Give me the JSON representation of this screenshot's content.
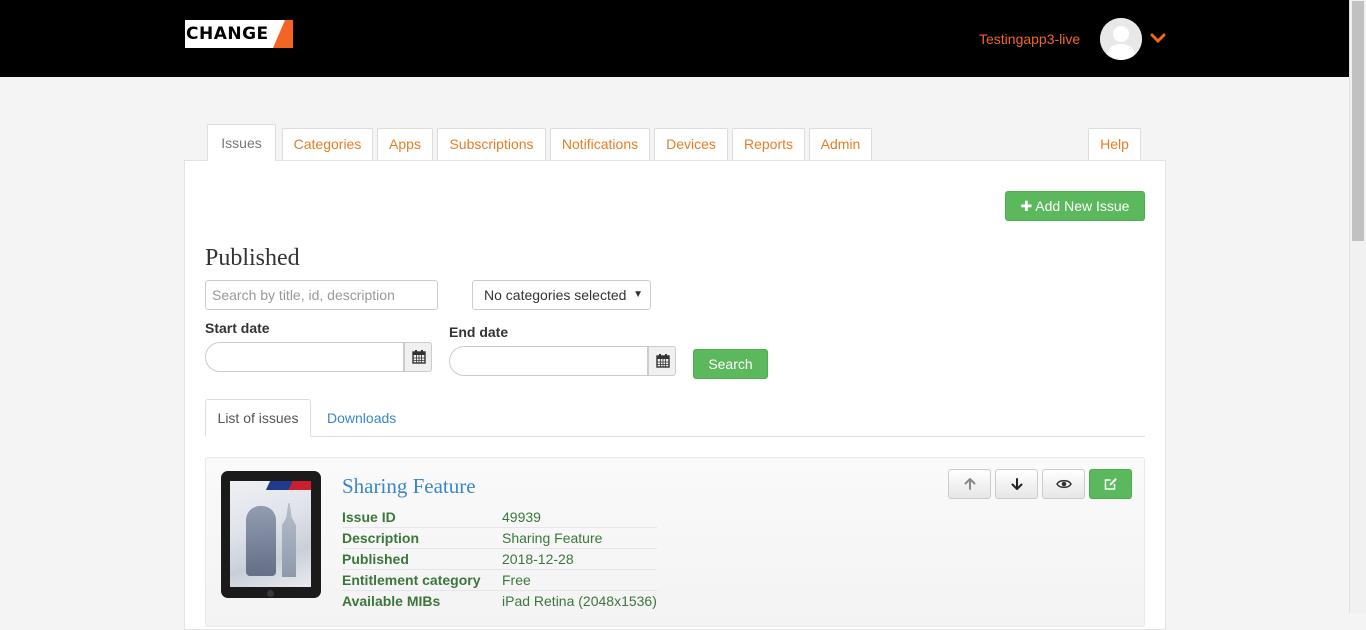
{
  "header": {
    "logo_text": "CHANGE",
    "account_name": "Testingapp3-live",
    "colors": {
      "brand": "#f26522",
      "bar": "#000000"
    }
  },
  "nav": {
    "tabs": [
      {
        "label": "Issues",
        "active": true
      },
      {
        "label": "Categories"
      },
      {
        "label": "Apps"
      },
      {
        "label": "Subscriptions"
      },
      {
        "label": "Notifications"
      },
      {
        "label": "Devices"
      },
      {
        "label": "Reports"
      },
      {
        "label": "Admin"
      },
      {
        "label": "Help"
      }
    ]
  },
  "main": {
    "add_button_label": "Add New Issue",
    "heading": "Published",
    "search_placeholder": "Search by title, id, description",
    "category_select_value": "No categories selected",
    "start_date_label": "Start date",
    "end_date_label": "End date",
    "search_button_label": "Search",
    "subtabs": [
      {
        "label": "List of issues",
        "active": true
      },
      {
        "label": "Downloads"
      }
    ]
  },
  "issue": {
    "title": "Sharing Feature",
    "fields": [
      {
        "label": "Issue ID",
        "value": "49939"
      },
      {
        "label": "Description",
        "value": "Sharing Feature"
      },
      {
        "label": "Published",
        "value": "2018-12-28"
      },
      {
        "label": "Entitlement category",
        "value": "Free"
      },
      {
        "label": "Available MIBs",
        "value": "iPad Retina (2048x1536)"
      }
    ],
    "actions": [
      "arrow-up-icon",
      "arrow-down-icon",
      "eye-icon",
      "edit-icon"
    ]
  }
}
